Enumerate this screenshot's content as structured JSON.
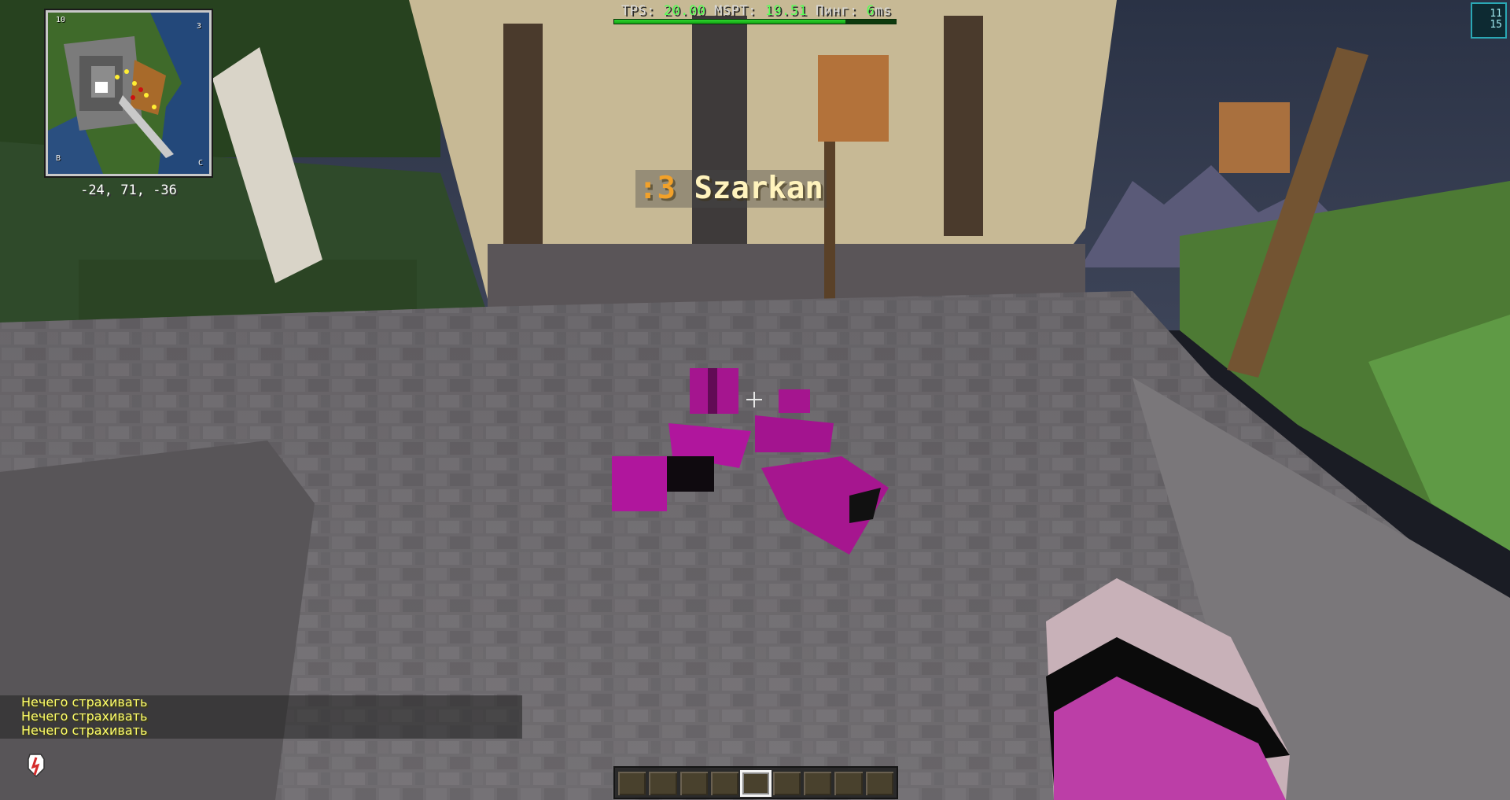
{
  "server_stats": {
    "tps_label": "TPS:",
    "tps_value": "20.00",
    "mspt_label": "MSPT:",
    "mspt_value": "19.51",
    "ping_label": "Пинг:",
    "ping_value": "6",
    "ping_unit": "ms",
    "tps_bar_fraction": 0.82
  },
  "minimap": {
    "corner_top_left": "10",
    "corner_top_right": "3",
    "corner_bottom_left": "B",
    "corner_bottom_right": "C",
    "coordinates": "-24, 71, -36"
  },
  "clock": {
    "line1": "11",
    "line2": "15"
  },
  "nameplate": {
    "prefix": ":3",
    "player_name": "Szarkan"
  },
  "chat": {
    "messages": [
      "Нечего страхивать",
      "Нечего страхивать",
      "Нечего страхивать"
    ]
  },
  "status_icon": "armor-shield-icon",
  "hotbar": {
    "slot_count": 9,
    "selected_slot": 5
  },
  "colors": {
    "stat_value": "#55ff55",
    "chat_text": "#ffff66",
    "nameplate_prefix": "#f1a12a",
    "nameplate_name": "#fff3bd",
    "armor_pink": "#b0169d"
  }
}
